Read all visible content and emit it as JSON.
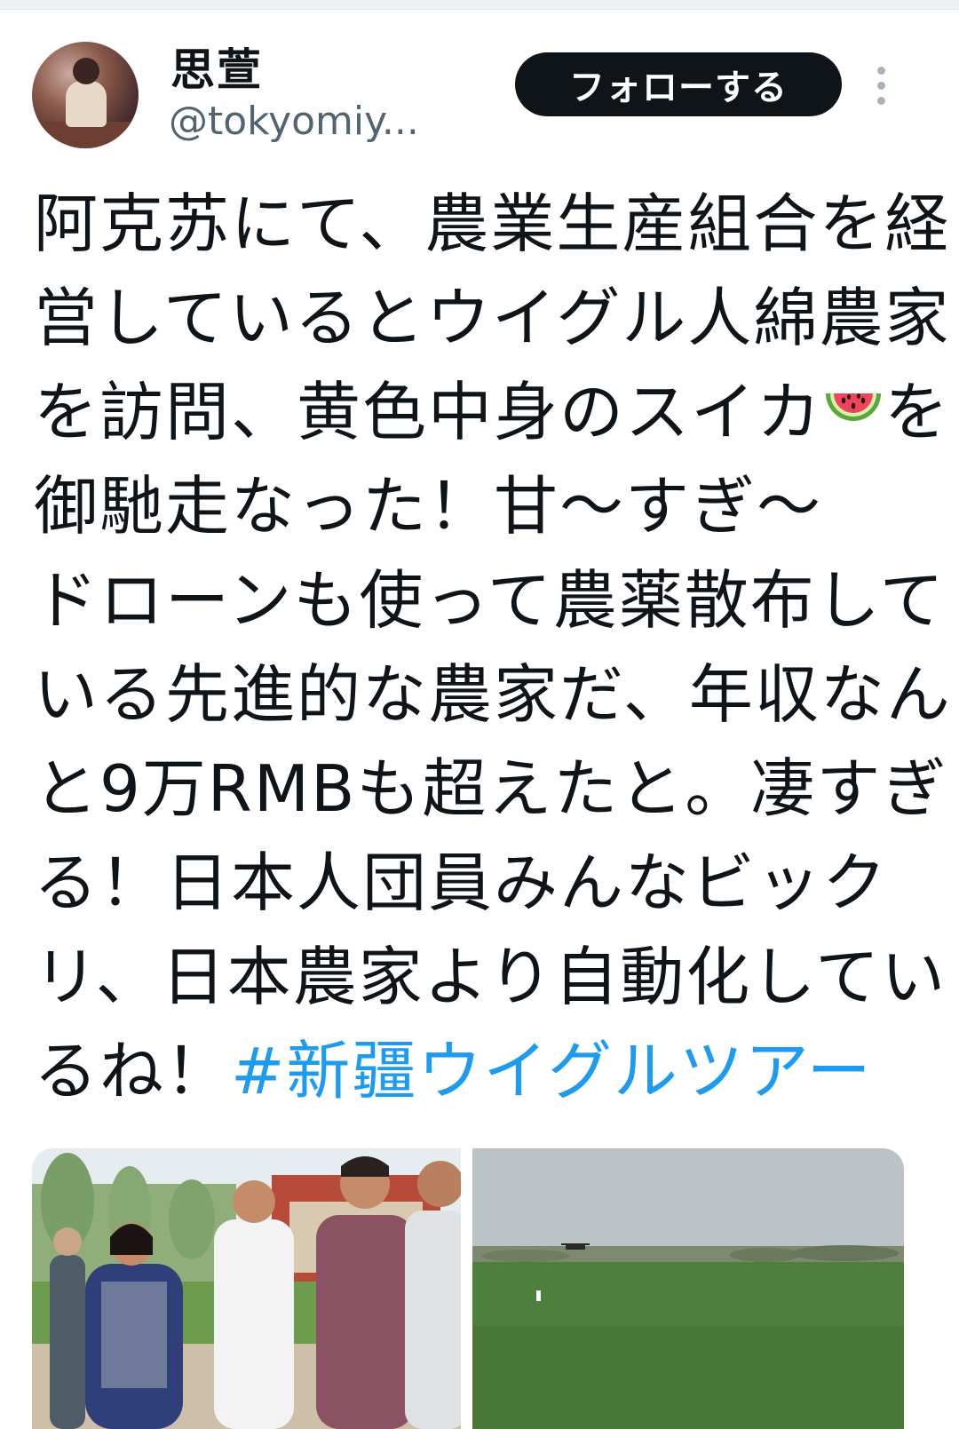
{
  "author": {
    "display_name": "思萱",
    "handle": "@tokyomiy..."
  },
  "actions": {
    "follow_label": "フォローする",
    "more_icon": "more-vertical-icon"
  },
  "tweet": {
    "lines": [
      "阿克苏にて、農業生産組合を経",
      "営しているとウイグル人綿農家",
      "を訪問、黄色中身のスイカ",
      "を",
      "御馳走なった！甘〜すぎ〜",
      "ドローンも使って農薬散布して",
      "いる先進的な農家だ、年収なん",
      "と9万RMBも超えたと。凄すぎ",
      "る！日本人団員みんなビック",
      "リ、日本農家より自動化してい",
      "るね！"
    ],
    "hashtag": "#新疆ウイグルツアー",
    "emoji": "watermelon-icon"
  },
  "media": {
    "items": [
      {
        "name": "group-photo"
      },
      {
        "name": "field-drone-photo"
      }
    ]
  },
  "colors": {
    "text": "#0f1419",
    "secondary": "#536471",
    "link": "#1d9bf0",
    "button_bg": "#0f1419",
    "button_text": "#ffffff"
  }
}
